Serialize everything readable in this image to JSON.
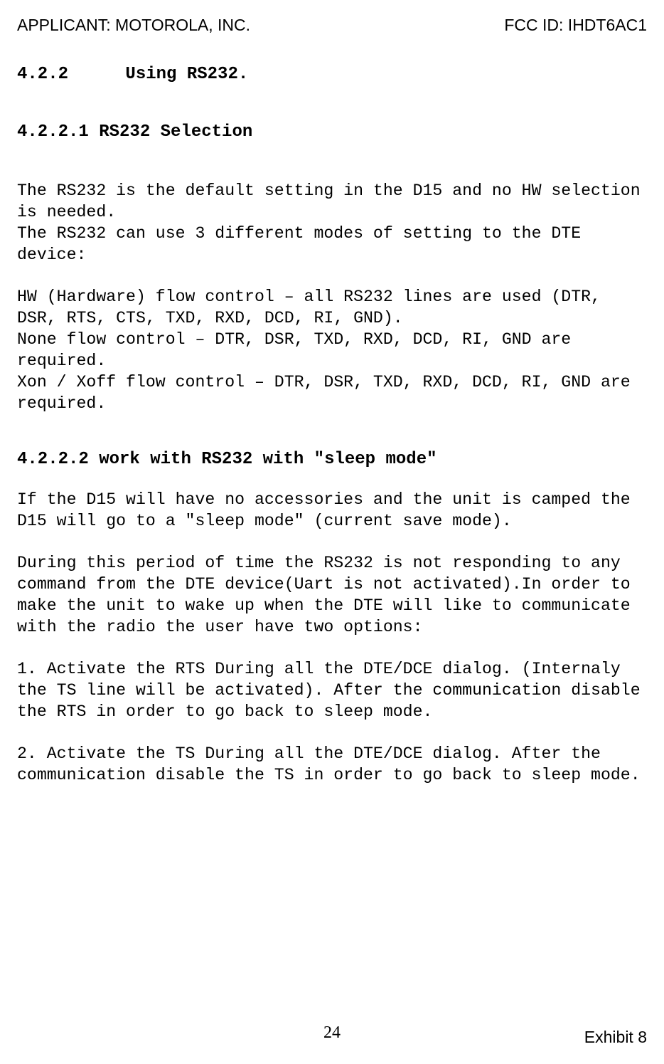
{
  "header": {
    "applicant_label": "APPLICANT:  MOTOROLA, INC.",
    "fcc_id": "FCC ID: IHDT6AC1"
  },
  "section_422": {
    "number": "4.2.2",
    "title": "Using RS232."
  },
  "section_4221": {
    "heading": "4.2.2.1  RS232 Selection",
    "p1": "The RS232 is the default setting in the D15 and no HW selection is needed.\nThe RS232 can use 3 different modes of setting to the DTE device:",
    "p2": "HW (Hardware) flow control – all RS232 lines are used (DTR, DSR, RTS, CTS, TXD, RXD, DCD, RI, GND).\nNone flow control – DTR, DSR, TXD, RXD, DCD, RI, GND are required.\nXon / Xoff flow control – DTR, DSR, TXD, RXD, DCD, RI, GND are required."
  },
  "section_4222": {
    "heading": "4.2.2.2 work with RS232 with \"sleep mode\"",
    "p1": "If the D15 will have no accessories and the unit is camped the D15 will go to a \"sleep mode\" (current save mode).",
    "p2": "During this period of time the RS232 is not responding to any command from the DTE device(Uart is not activated).In order to make the unit to wake up when the DTE will like to communicate with the radio the user have two options:",
    "p3": "1. Activate the RTS During all the DTE/DCE dialog. (Internaly the TS line will be activated). After the communication disable the RTS in order to go back to sleep mode.",
    "p4": "2. Activate the TS During all the DTE/DCE dialog. After the communication disable the TS in order to go back to sleep mode."
  },
  "footer": {
    "page_number": "24",
    "exhibit": "Exhibit 8"
  }
}
